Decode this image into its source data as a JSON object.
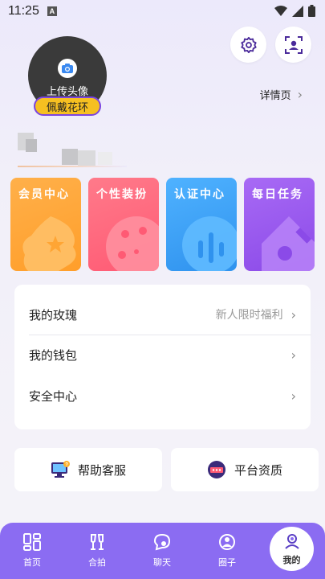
{
  "status_bar": {
    "time": "11:25",
    "notif_letter": "A"
  },
  "header": {
    "upload_avatar": "上传头像",
    "wear_wreath": "佩戴花环",
    "details": "详情页"
  },
  "feature_cards": [
    {
      "label": "会员中心",
      "color": "#ffa83a"
    },
    {
      "label": "个性装扮",
      "color": "#ff6b81"
    },
    {
      "label": "认证中心",
      "color": "#3ba0f5"
    },
    {
      "label": "每日任务",
      "color": "#9d5cf0"
    }
  ],
  "menu": {
    "items": [
      {
        "label": "我的玫瑰",
        "extra": "新人限时福利"
      },
      {
        "label": "我的钱包",
        "extra": ""
      },
      {
        "label": "安全中心",
        "extra": ""
      }
    ]
  },
  "quick_links": [
    {
      "label": "帮助客服",
      "icon": "help-desk-icon"
    },
    {
      "label": "平台资质",
      "icon": "certificate-icon"
    }
  ],
  "tabbar": {
    "tabs": [
      {
        "label": "首页",
        "icon": "home-grid-icon"
      },
      {
        "label": "合拍",
        "icon": "match-icon"
      },
      {
        "label": "聊天",
        "icon": "chat-icon"
      },
      {
        "label": "圈子",
        "icon": "circle-icon"
      },
      {
        "label": "我的",
        "icon": "profile-icon",
        "active": true
      }
    ]
  },
  "colors": {
    "accent": "#8b6cf2",
    "badge": "#f6c021"
  }
}
